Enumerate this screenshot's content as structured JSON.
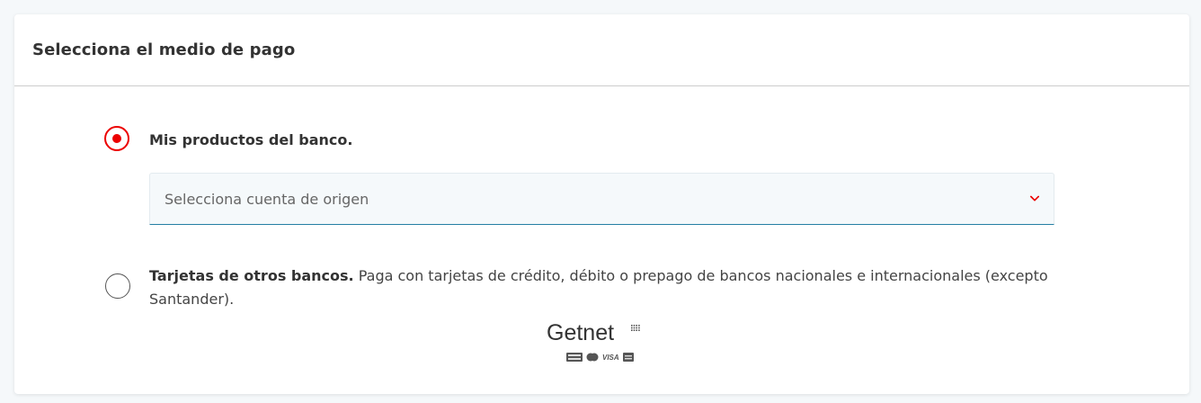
{
  "card": {
    "title": "Selecciona el medio de pago"
  },
  "options": {
    "bank_products": {
      "label": "Mis productos del banco.",
      "selected": true
    },
    "account_select": {
      "placeholder": "Selecciona cuenta de origen",
      "icon": "chevron-down-icon"
    },
    "other_cards": {
      "label_bold": "Tarjetas de otros bancos.",
      "description": " Paga con tarjetas de crédito, débito o prepago de bancos nacionales e internacionales (excepto Santander).",
      "selected": false
    }
  },
  "getnet": {
    "brand": "Getnet",
    "card_brands": [
      "VISA"
    ]
  },
  "colors": {
    "accent": "#ec0000",
    "select_underline": "#257fa4"
  }
}
